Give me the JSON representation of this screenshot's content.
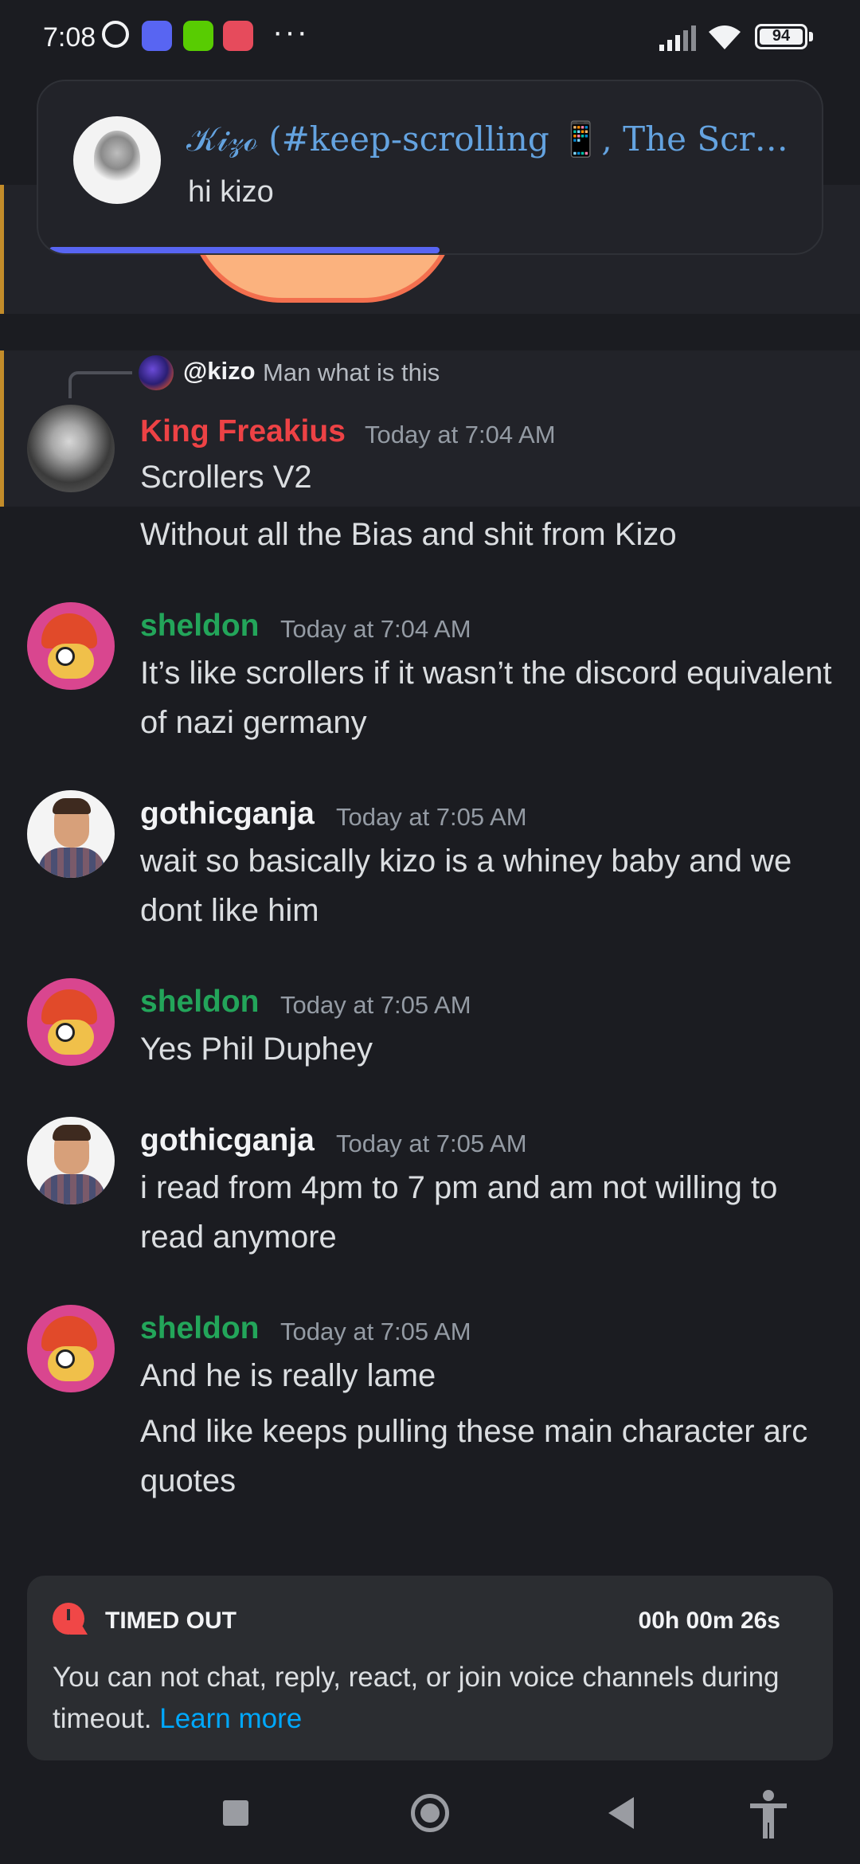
{
  "status_bar": {
    "time": "7:08",
    "battery": "94",
    "overflow": "···"
  },
  "notification": {
    "title": "𝒦𝒾𝓏ℴ (#keep-scrolling 📱, The Scroll...",
    "body": "hi kizo"
  },
  "reply_preview": {
    "user": "@kizo",
    "text": "Man what is this"
  },
  "messages": [
    {
      "author": "King Freakius",
      "author_color": "#ed4245",
      "timestamp": "Today at 7:04 AM",
      "lines": [
        "Scrollers V2",
        "Without all the Bias and shit from Kizo"
      ]
    },
    {
      "author": "sheldon",
      "author_color": "#23a55a",
      "timestamp": "Today at 7:04 AM",
      "lines": [
        "It’s like scrollers if it wasn’t the discord equivalent of nazi germany"
      ]
    },
    {
      "author": "gothicganja",
      "author_color": "#f2f3f5",
      "timestamp": "Today at 7:05 AM",
      "lines": [
        "wait so basically kizo is a whiney baby and we dont like him"
      ]
    },
    {
      "author": "sheldon",
      "author_color": "#23a55a",
      "timestamp": "Today at 7:05 AM",
      "lines": [
        "Yes Phil Duphey"
      ]
    },
    {
      "author": "gothicganja",
      "author_color": "#f2f3f5",
      "timestamp": "Today at 7:05 AM",
      "lines": [
        "i read from 4pm to 7 pm and am not willing to read anymore"
      ]
    },
    {
      "author": "sheldon",
      "author_color": "#23a55a",
      "timestamp": "Today at 7:05 AM",
      "lines": [
        "And he is really lame",
        "And like keeps pulling these main character arc quotes"
      ]
    }
  ],
  "timeout": {
    "title": "TIMED OUT",
    "timer": "00h 00m 26s",
    "text": "You can not chat, reply, react, or join voice channels during timeout.",
    "link": "Learn more"
  },
  "icons": {
    "status": [
      "alarm-icon",
      "discord-icon",
      "duolingo-icon",
      "game-icon",
      "signal-icon",
      "wifi-icon",
      "battery-icon"
    ],
    "nav": [
      "recents-icon",
      "home-icon",
      "back-icon",
      "accessibility-icon"
    ]
  },
  "colors": {
    "background": "#1b1c21",
    "accent": "#5865f2",
    "link": "#00a8fc",
    "mention_bar": "#c38c2a"
  }
}
